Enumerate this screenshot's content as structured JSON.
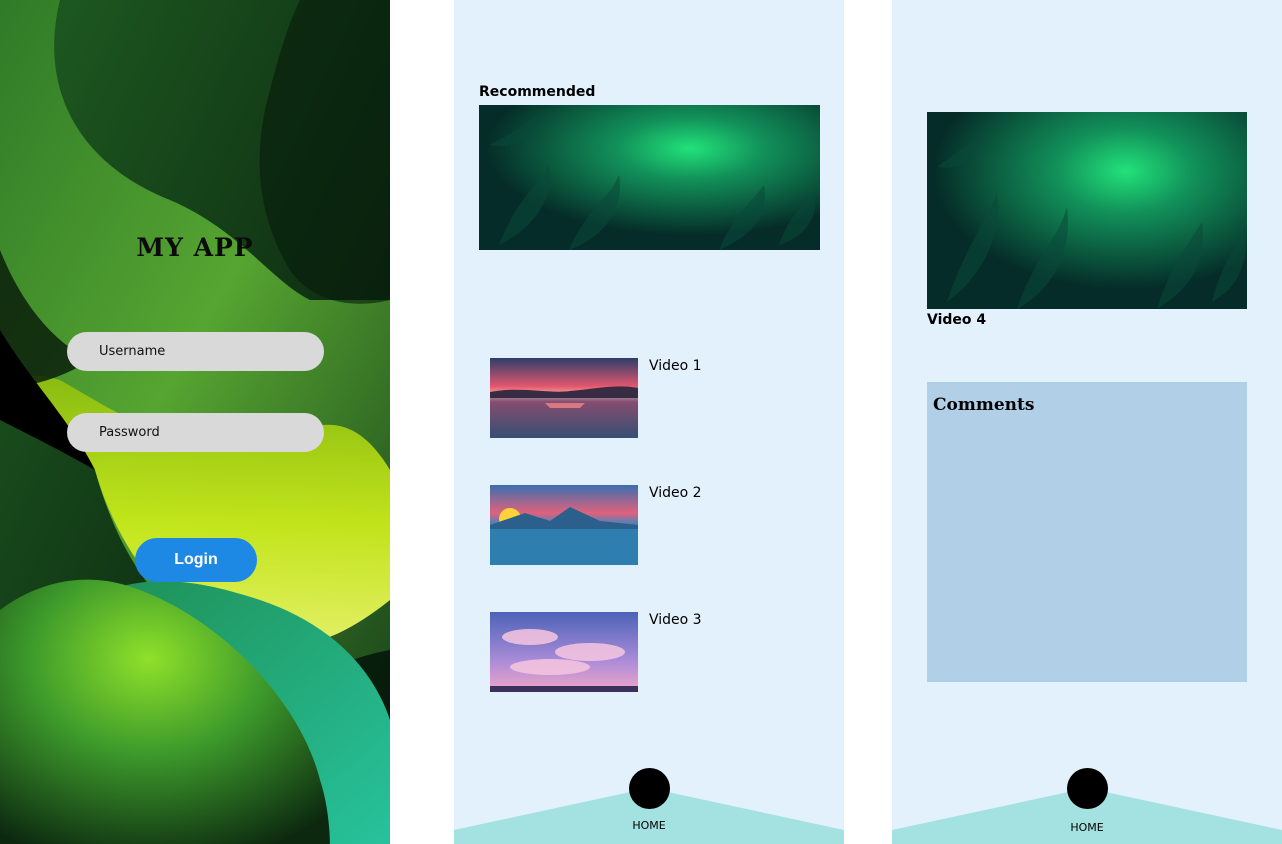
{
  "login": {
    "app_title": "MY APP",
    "username_placeholder": "Username",
    "password_placeholder": "Password",
    "login_label": "Login"
  },
  "home": {
    "recommended_label": "Recommended",
    "videos": [
      {
        "label": "Video 1"
      },
      {
        "label": "Video 2"
      },
      {
        "label": "Video 3"
      }
    ],
    "nav": {
      "home_label": "HOME"
    }
  },
  "player": {
    "video_title": "Video 4",
    "comments_label": "Comments",
    "nav": {
      "home_label": "HOME"
    }
  },
  "colors": {
    "screen_bg": "#e3f1fc",
    "nav_teal": "#a3e2e0",
    "login_button": "#1e88e5",
    "input_bg": "#d9d9d9",
    "comments_bg": "#b1d0e8"
  },
  "icons": {
    "home_nav": "home-dot-icon"
  }
}
